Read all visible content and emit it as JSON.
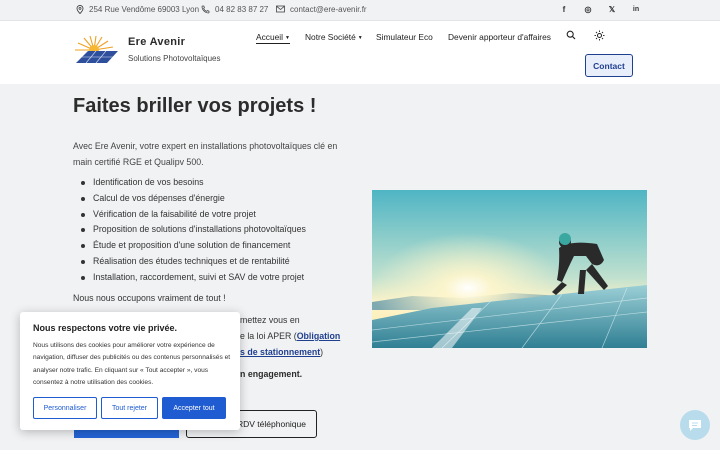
{
  "topbar": {
    "address": "254 Rue Vendôme 69003 Lyon",
    "phone": "04 82 83 87 27",
    "email": "contact@ere-avenir.fr",
    "social": [
      {
        "icon": "facebook-icon",
        "glyph": "f"
      },
      {
        "icon": "instagram-icon",
        "glyph": "◎"
      },
      {
        "icon": "x-icon",
        "glyph": "𝕏"
      },
      {
        "icon": "linkedin-icon",
        "glyph": "in"
      }
    ]
  },
  "header": {
    "brand": "Ere Avenir",
    "tagline": "Solutions Photovoltaïques",
    "nav": [
      {
        "label": "Accueil",
        "dropdown": true,
        "active": true
      },
      {
        "label": "Notre Société",
        "dropdown": true
      },
      {
        "label": "Simulateur Eco"
      },
      {
        "label": "Devenir apporteur d'affaires"
      }
    ],
    "contact_label": "Contact"
  },
  "main": {
    "title": "Faites briller vos projets !",
    "intro": "Avec Ere Avenir, votre expert en installations photovoltaïques clé en main certifié RGE et Qualipv 500.",
    "features": [
      "Identification de vos besoins",
      "Calcul de vos dépenses d'énergie",
      "Vérification de la faisabilité de votre projet",
      "Proposition de solutions d'installations photovoltaïques",
      "Étude et proposition d'une solution de financement",
      "Réalisation des études techniques et de rentabilité",
      "Installation, raccordement, suivi et SAV de votre projet"
    ],
    "outro": "Nous nous occupons vraiment de tout !",
    "partial_line_1": "mettez vous en",
    "partial_line_2_prefix": "e la loi APER (",
    "partial_line_2_link": "Obligation",
    "partial_line_3_link": "s de stationnement",
    "partial_line_3_suffix": ")",
    "partial_line_4": "n engagement.",
    "rdv_button": "RDV téléphonique"
  },
  "cookie": {
    "title": "Nous respectons votre vie privée.",
    "text": "Nous utilisons des cookies pour améliorer votre expérience de navigation, diffuser des publicités ou des contenus personnalisés et analyser notre trafic. En cliquant sur « Tout accepter », vous consentez à notre utilisation des cookies.",
    "customize": "Personnaliser",
    "reject": "Tout rejeter",
    "accept": "Accepter tout"
  },
  "colors": {
    "primary": "#1f5bd1",
    "navy": "#1f3f8f",
    "background": "#f1f2f4"
  }
}
